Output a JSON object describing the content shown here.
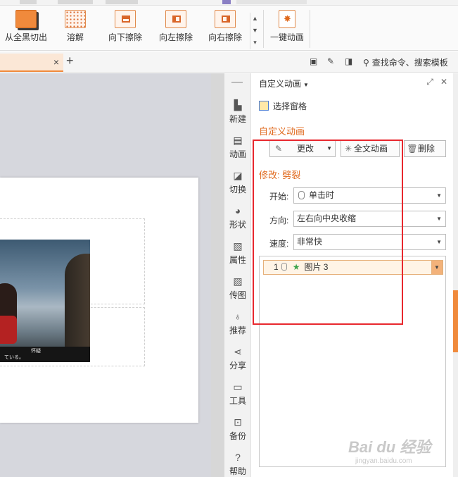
{
  "ribbon": {
    "buttons": [
      {
        "label": "从全黑切出",
        "icon": "black-cut-icon"
      },
      {
        "label": "溶解",
        "icon": "dissolve-icon"
      },
      {
        "label": "向下擦除",
        "icon": "wipe-down-icon"
      },
      {
        "label": "向左擦除",
        "icon": "wipe-left-icon"
      },
      {
        "label": "向右擦除",
        "icon": "wipe-right-icon"
      },
      {
        "label": "一键动画",
        "icon": "one-click-animation-icon"
      }
    ]
  },
  "tabbar": {
    "close_glyph": "×",
    "new_tab_glyph": "+",
    "search_label": "查找命令、搜索模板"
  },
  "slide": {
    "photo_caption_line1": "怀疑",
    "photo_caption_line2": "ている。"
  },
  "rail": {
    "items": [
      {
        "label": "新建",
        "icon": "new-file-icon"
      },
      {
        "label": "动画",
        "icon": "animation-icon"
      },
      {
        "label": "切换",
        "icon": "transition-icon"
      },
      {
        "label": "形状",
        "icon": "shape-icon"
      },
      {
        "label": "属性",
        "icon": "properties-icon"
      },
      {
        "label": "传图",
        "icon": "upload-image-icon"
      },
      {
        "label": "推荐",
        "icon": "recommend-icon"
      },
      {
        "label": "分享",
        "icon": "share-icon"
      },
      {
        "label": "工具",
        "icon": "toolbox-icon"
      },
      {
        "label": "备份",
        "icon": "backup-icon"
      },
      {
        "label": "帮助",
        "icon": "help-icon"
      }
    ]
  },
  "pane": {
    "title": "自定义动画",
    "select_grid_label": "选择窗格",
    "section_title": "自定义动画",
    "change_button": "更改",
    "preview_button": "全文动画",
    "delete_button": "删除",
    "modify_title": "修改: 劈裂",
    "start_label": "开始:",
    "start_value": "单击时",
    "direction_label": "方向:",
    "direction_value": "左右向中央收缩",
    "speed_label": "速度:",
    "speed_value": "非常快",
    "list_items": [
      {
        "number": "1",
        "name": "图片 3"
      }
    ]
  },
  "watermark": {
    "brand": "Bai du 经验",
    "url": "jingyan.baidu.com"
  },
  "colors": {
    "accent": "#f08a3c",
    "section_title": "#e06a1e",
    "annotation": "#e8282e"
  }
}
